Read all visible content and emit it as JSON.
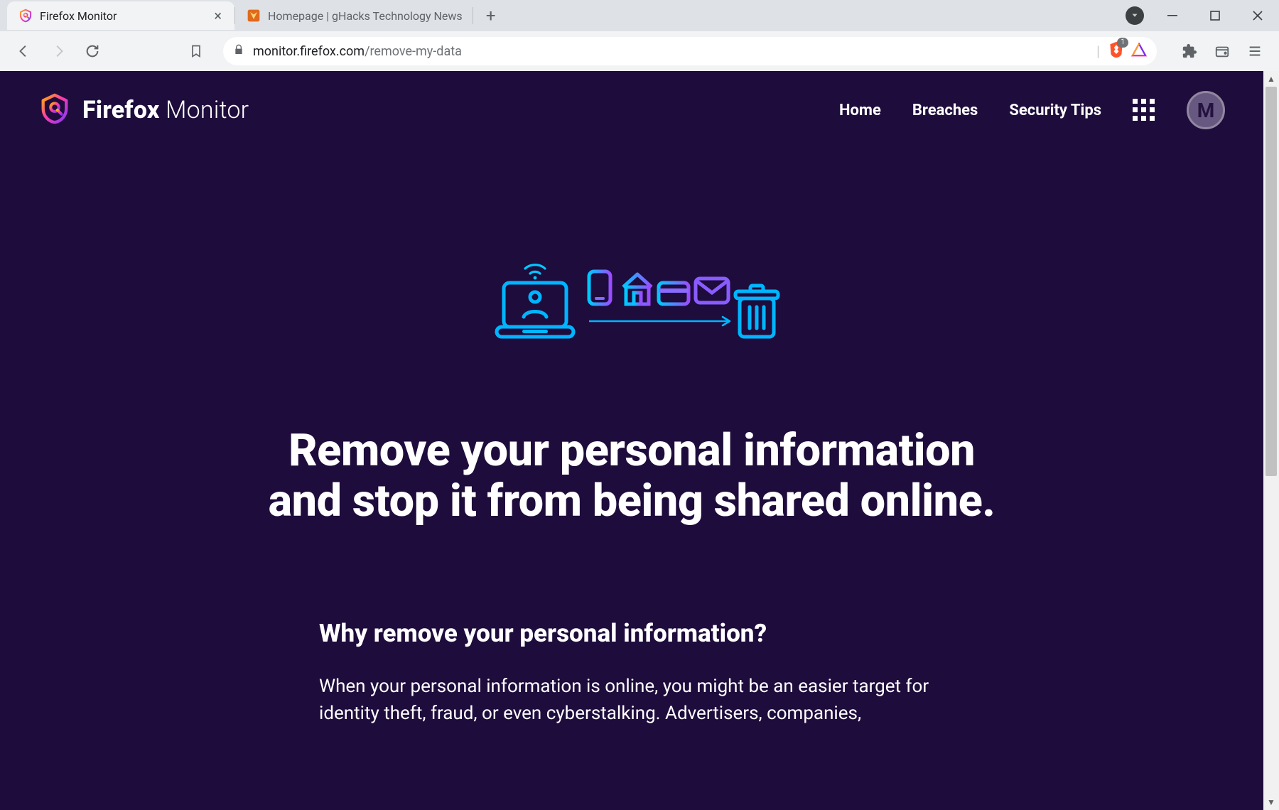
{
  "browser": {
    "tabs": [
      {
        "title": "Firefox Monitor",
        "active": true
      },
      {
        "title": "Homepage | gHacks Technology News",
        "active": false
      }
    ],
    "url_host": "monitor.firefox.com",
    "url_path": "/remove-my-data",
    "brave_count": "1"
  },
  "page": {
    "brand_bold": "Firefox",
    "brand_light": " Monitor",
    "nav": {
      "home": "Home",
      "breaches": "Breaches",
      "tips": "Security Tips"
    },
    "avatar_initial": "M",
    "hero_title": "Remove your personal information and stop it from being shared online.",
    "section_heading": "Why remove your personal information?",
    "section_body": "When your personal information is online, you might be an easier target for identity theft, fraud, or even cyberstalking. Advertisers, companies,"
  }
}
